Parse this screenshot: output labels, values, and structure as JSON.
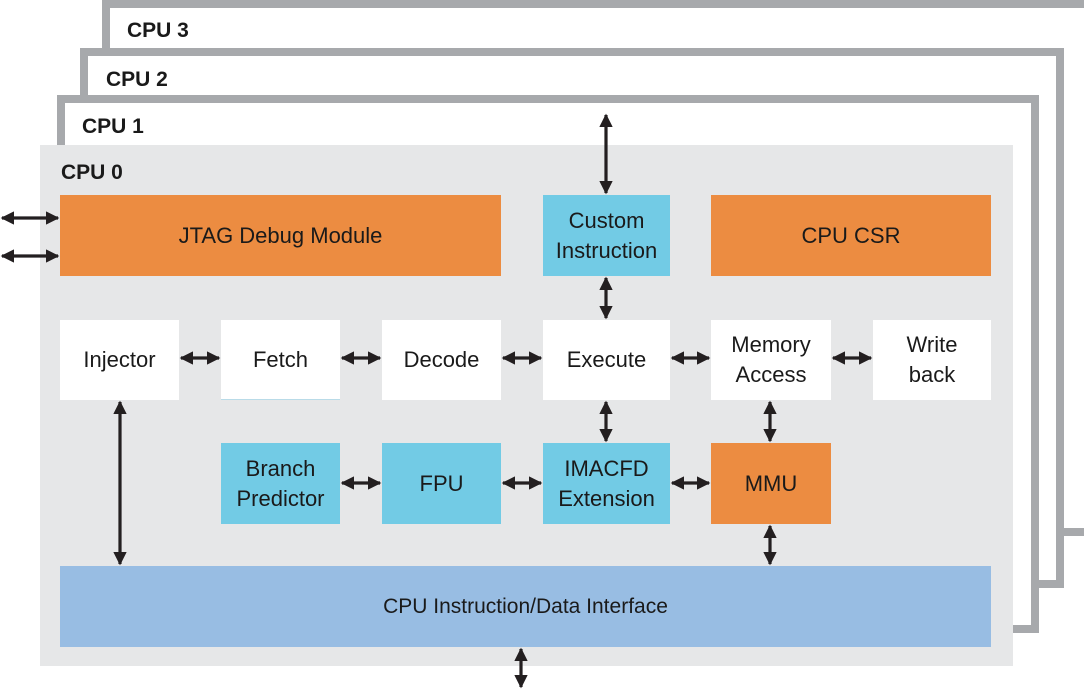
{
  "diagram": {
    "frames": {
      "cpu3": "CPU 3",
      "cpu2": "CPU 2",
      "cpu1": "CPU 1",
      "cpu0": "CPU 0"
    },
    "blocks": {
      "jtag": "JTAG Debug Module",
      "custom_instruction": [
        "Custom",
        "Instruction"
      ],
      "cpu_csr": "CPU CSR",
      "injector": "Injector",
      "fetch": "Fetch",
      "decode": "Decode",
      "execute": "Execute",
      "memory_access": [
        "Memory",
        "Access"
      ],
      "write_back": [
        "Write",
        "back"
      ],
      "branch_predictor": [
        "Branch",
        "Predictor"
      ],
      "fpu": "FPU",
      "imacfd": [
        "IMACFD",
        "Extension"
      ],
      "mmu": "MMU",
      "interface": "CPU Instruction/Data Interface"
    },
    "colors": {
      "frame_border": "#a7a9ac",
      "cpu0_bg": "#e6e7e8",
      "orange": "#ec8c41",
      "cyan": "#72cbe5",
      "blue": "#98bde3",
      "arrow": "#231f20"
    },
    "connections": [
      [
        "external",
        "jtag"
      ],
      [
        "external",
        "jtag"
      ],
      [
        "external",
        "custom_instruction"
      ],
      [
        "custom_instruction",
        "execute"
      ],
      [
        "injector",
        "fetch"
      ],
      [
        "fetch",
        "decode"
      ],
      [
        "decode",
        "execute"
      ],
      [
        "execute",
        "memory_access"
      ],
      [
        "memory_access",
        "write_back"
      ],
      [
        "execute",
        "imacfd"
      ],
      [
        "memory_access",
        "mmu"
      ],
      [
        "branch_predictor",
        "fpu"
      ],
      [
        "fpu",
        "imacfd"
      ],
      [
        "imacfd",
        "mmu"
      ],
      [
        "injector",
        "interface"
      ],
      [
        "mmu",
        "interface"
      ],
      [
        "interface",
        "external"
      ]
    ]
  }
}
